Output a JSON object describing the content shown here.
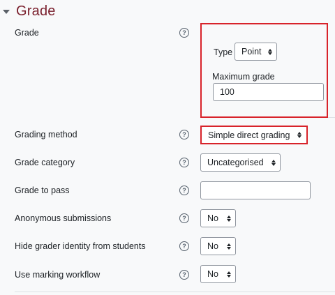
{
  "section": {
    "title": "Grade"
  },
  "grade": {
    "label": "Grade",
    "type_label": "Type",
    "type_value": "Point",
    "max_label": "Maximum grade",
    "max_value": "100"
  },
  "rows": {
    "grading_method": {
      "label": "Grading method",
      "value": "Simple direct grading"
    },
    "grade_category": {
      "label": "Grade category",
      "value": "Uncategorised"
    },
    "grade_to_pass": {
      "label": "Grade to pass",
      "value": ""
    },
    "anonymous": {
      "label": "Anonymous submissions",
      "value": "No"
    },
    "hide_grader": {
      "label": "Hide grader identity from students",
      "value": "No"
    },
    "marking_workflow": {
      "label": "Use marking workflow",
      "value": "No"
    }
  },
  "colors": {
    "title": "#7a1f2c",
    "highlight": "#d8232a"
  },
  "icons": {
    "help": "question-circle-icon",
    "expand": "chevron-down-icon"
  }
}
